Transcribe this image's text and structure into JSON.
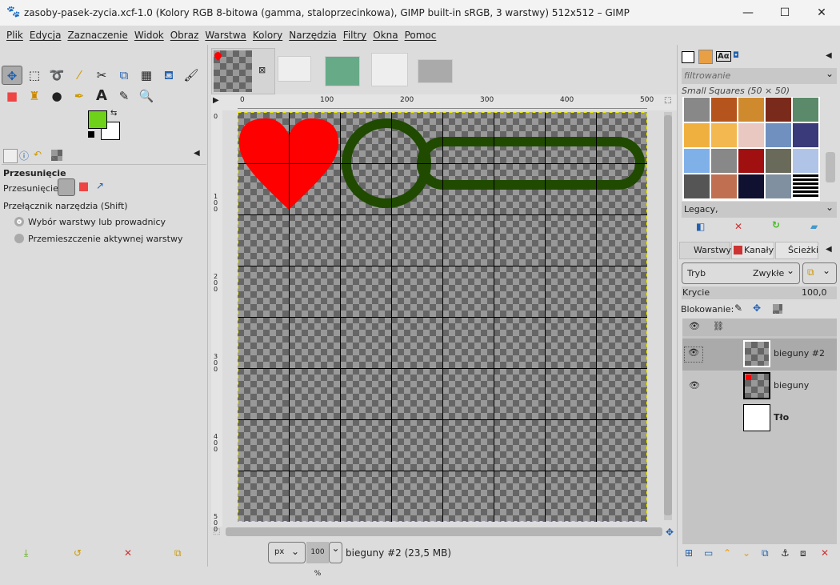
{
  "window": {
    "title": "zasoby-pasek-zycia.xcf-1.0 (Kolory RGB 8-bitowa (gamma, staloprzecinkowa), GIMP built-in sRGB, 3 warstwy) 512x512 – GIMP",
    "minimize": "—",
    "maximize": "☐",
    "close": "✕"
  },
  "menu": [
    "Plik",
    "Edycja",
    "Zaznaczenie",
    "Widok",
    "Obraz",
    "Warstwa",
    "Kolory",
    "Narzędzia",
    "Filtry",
    "Okna",
    "Pomoc"
  ],
  "colors": {
    "foreground": "#6fd11a",
    "background": "#ffffff",
    "heart": "#ff0000",
    "bar": "#1f4a00",
    "accent": "#1f5fb0"
  },
  "tool_options": {
    "title": "Przesunięcie",
    "move_label": "Przesunięcie:",
    "toggle_label": "Przełącznik narzędzia  (Shift)",
    "options": [
      "Wybór warstwy lub prowadnicy",
      "Przemieszczenie aktywnej warstwy"
    ],
    "selected": 0
  },
  "ruler": {
    "h_ticks": [
      "0",
      "100",
      "200",
      "300",
      "400",
      "500"
    ],
    "v_ticks": [
      "0",
      "1\n0\n0",
      "2\n0\n0",
      "3\n0\n0",
      "4\n0\n0",
      "5\n0\n0"
    ]
  },
  "statusbar": {
    "unit": "px",
    "zoom": "100 %",
    "info": "bieguny #2 (23,5 MB)"
  },
  "patterns": {
    "filter_placeholder": "filtrowanie",
    "title": "Small Squares (50 × 50)",
    "tag": "Legacy,"
  },
  "layers_panel": {
    "tabs": [
      "Warstwy",
      "Kanały",
      "Ścieżki"
    ],
    "mode_label": "Tryb",
    "mode_value": "Zwykłe",
    "opacity_label": "Krycie",
    "opacity_value": "100,0",
    "lock_label": "Blokowanie:",
    "layers": [
      {
        "name": "bieguny #2",
        "visible": true,
        "active": true
      },
      {
        "name": "bieguny",
        "visible": true,
        "active": false
      },
      {
        "name": "Tło",
        "visible": false,
        "active": false
      }
    ]
  }
}
